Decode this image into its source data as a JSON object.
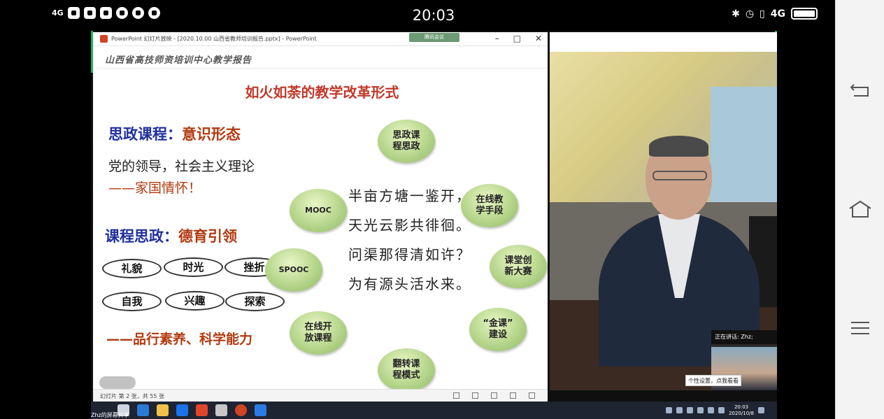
{
  "status_bar": {
    "network": "4G",
    "time": "20:03",
    "network_right": "4G"
  },
  "ppt": {
    "window_title": "PowerPoint 幻灯片放映 - [2020.10.00 山西省教师培训报告.pptx] - PowerPoint",
    "share_tag": "腾讯会议",
    "status_text": "幻灯片 第 2 张，共 55 张"
  },
  "slide": {
    "header": "山西省高技师资培训中心教学报告",
    "title": "如火如荼的教学改革形式",
    "left": {
      "heading1_blue": "思政课程：",
      "heading1_brown": "意识形态",
      "line1": "党的领导，社会主义理论",
      "line2": "——家国情怀！",
      "heading2_blue": "课程思政：",
      "heading2_brown": "德育引领",
      "pills": [
        "礼貌",
        "时光",
        "挫折",
        "自我",
        "兴趣",
        "探索"
      ],
      "footer": "——品行素养、科学能力"
    },
    "poem": [
      "半亩方塘一鉴开，",
      "天光云影共徘徊。",
      "问渠那得清如许？",
      "为有源头活水来。"
    ],
    "bubbles": [
      "思政课\n程思政",
      "MOOC",
      "在线教\n学手段",
      "SPOOC",
      "课堂创\n新大赛",
      "在线开\n放课程",
      "“金课”\n建设",
      "翻转课\n程模式"
    ]
  },
  "video": {
    "speaking_label": "正在讲话: Zhz;",
    "tooltip": "个性设置，点我看看"
  },
  "taskbar": {
    "presenter": "Zhz的屏幕共享",
    "time": "20:03",
    "date": "2020/10/8"
  }
}
